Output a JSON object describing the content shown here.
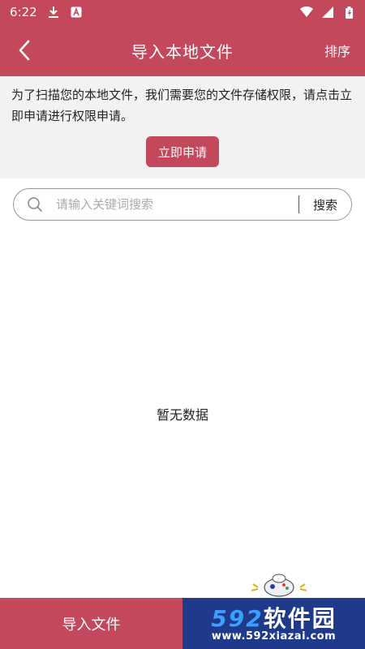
{
  "status_bar": {
    "time": "6:22",
    "icons": [
      "download-icon",
      "a-box-icon",
      "wifi-icon",
      "signal-icon",
      "battery-icon"
    ]
  },
  "app_bar": {
    "title": "导入本地文件",
    "sort_label": "排序",
    "back_icon": "chevron-left-icon",
    "color": "#c3485c"
  },
  "permission_notice": {
    "text": "为了扫描您的本地文件，我们需要您的文件存储权限，请点击立即申请进行权限申请。",
    "apply_button": "立即申请"
  },
  "search": {
    "placeholder": "请输入关键词搜索",
    "value": "",
    "button_label": "搜索",
    "icon": "search-icon"
  },
  "empty_state": {
    "text": "暂无数据"
  },
  "bottom_bar": {
    "import_button": "导入文件"
  },
  "watermark": {
    "prefix": "592",
    "suffix": "软件园",
    "url": "www.592xiazai.com",
    "colors": {
      "background": "#1f3a8a",
      "accent": "#3aa0ff"
    }
  }
}
